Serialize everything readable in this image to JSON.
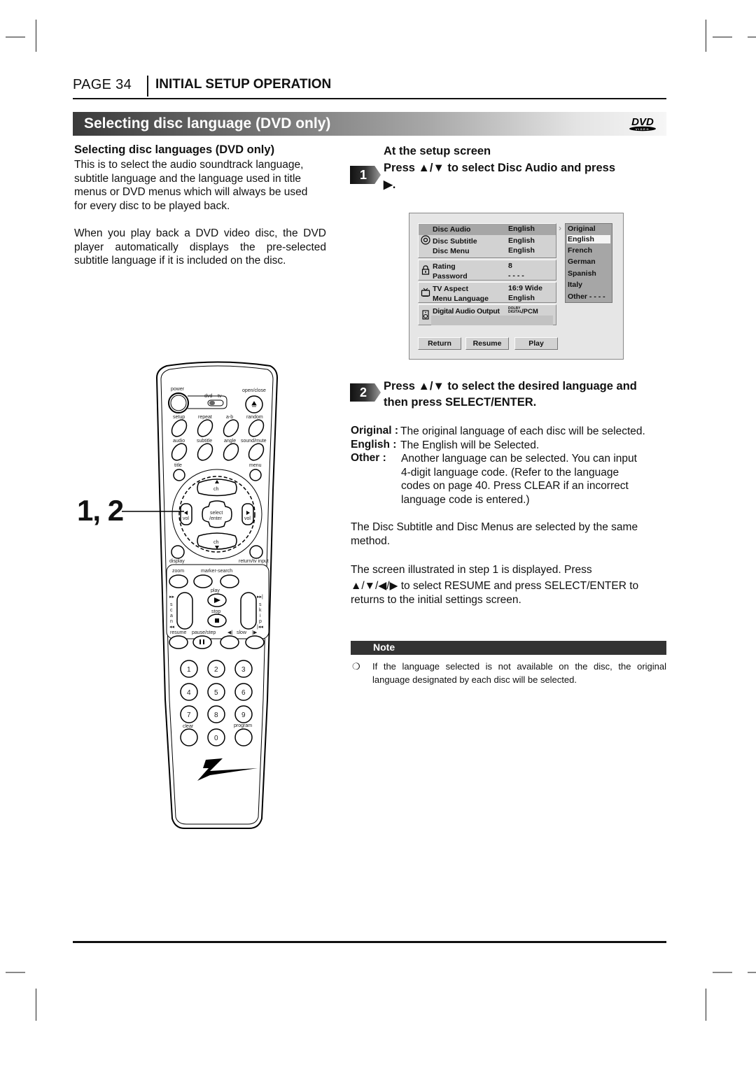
{
  "header": {
    "page_label": "PAGE 34",
    "section": "INITIAL SETUP OPERATION"
  },
  "banner": {
    "title": "Selecting disc language (DVD only)",
    "logo": {
      "main": "DVD",
      "sub": "VIDEO"
    }
  },
  "left": {
    "subheading": "Selecting disc languages (DVD only)",
    "paragraphs": [
      [
        "This is to select the audio soundtrack language,",
        "subtitle language and the language used in title",
        "menus or DVD menus which will always be used",
        "for every disc to be played back."
      ],
      [
        "When you play back a DVD video disc, the DVD",
        "player automatically displays the pre-selected",
        "subtitle language if it is included on the disc."
      ]
    ],
    "callout": "1, 2"
  },
  "step1": {
    "number": "1",
    "line1": "At the setup screen",
    "line2": "Press ▲/▼ to select   Disc Audio   and press",
    "line3": "▶."
  },
  "osd": {
    "groups": [
      {
        "icon": "disc-icon",
        "rows": [
          {
            "label": "Disc Audio",
            "value": "English",
            "highlighted": true
          },
          {
            "label": "Disc Subtitle",
            "value": "English"
          },
          {
            "label": "Disc Menu",
            "value": "English"
          }
        ]
      },
      {
        "icon": "lock-icon",
        "rows": [
          {
            "label": "Rating",
            "value": "8"
          },
          {
            "label": "Password",
            "value": "- - - -"
          }
        ]
      },
      {
        "icon": "tv-icon",
        "rows": [
          {
            "label": "TV Aspect",
            "value": "16:9 Wide"
          },
          {
            "label": "Menu Language",
            "value": "English"
          }
        ]
      },
      {
        "icon": "speaker-icon",
        "rows": [
          {
            "label": "Digital Audio Output",
            "value_top": "DOLBY",
            "value_bottom": "DIGITAL",
            "value_suffix": "/PCM"
          }
        ]
      }
    ],
    "options": [
      "Original",
      "English",
      "French",
      "German",
      "Spanish",
      "Italy",
      "Other - - - -"
    ],
    "selected_option": "English",
    "buttons": [
      "Return",
      "Resume",
      "Play"
    ]
  },
  "step2": {
    "number": "2",
    "line1": "Press ▲/▼ to select the desired language and",
    "line2": "then press SELECT/ENTER."
  },
  "definitions": [
    {
      "term": "Original :",
      "text": [
        "The original language of each disc will be selected."
      ]
    },
    {
      "term": "English :",
      "text": [
        "The English will be Selected."
      ]
    },
    {
      "term": "Other :",
      "text": [
        "Another language can be selected. You can input",
        "4-digit language code. (Refer to the language",
        "codes on page 40. Press CLEAR if an incorrect",
        "language code is entered.)"
      ]
    }
  ],
  "body": {
    "same_method": [
      "The Disc Subtitle and Disc Menus are selected by the same",
      "method."
    ],
    "resume": [
      "The screen illustrated in step 1 is displayed. Press",
      "▲/▼/◀/▶ to select RESUME and press SELECT/ENTER to",
      "returns to the initial settings screen."
    ]
  },
  "note": {
    "title": "Note",
    "bullet": "❍",
    "lines": [
      "If the language selected is not available on the disc, the original",
      "language designated by each disc will be selected."
    ]
  },
  "remote": {
    "labels": {
      "power": "power",
      "dvd": "dvd",
      "tv": "tv",
      "open_close": "open/close",
      "setup": "setup",
      "repeat": "repeat",
      "ab": "a-b",
      "random": "random",
      "audio": "audio",
      "subtitle": "subtitle",
      "angle": "angle",
      "sound_mute": "sound/mute",
      "title": "title",
      "menu": "menu",
      "ch": "ch",
      "vol": "vol",
      "select": "select",
      "enter": "/enter",
      "display": "display",
      "return_tv": "return/tv input",
      "zoom": "zoom",
      "marker_search": "marker-search",
      "play": "play",
      "stop": "stop",
      "resume": "resume",
      "pause_step": "pause/step",
      "slow": "slow",
      "scan": [
        "s",
        "c",
        "a",
        "n"
      ],
      "skip": [
        "s",
        "k",
        "i",
        "p"
      ],
      "clear": "clear",
      "program": "program"
    },
    "digits": [
      "1",
      "2",
      "3",
      "4",
      "5",
      "6",
      "7",
      "8",
      "9",
      "0"
    ]
  }
}
